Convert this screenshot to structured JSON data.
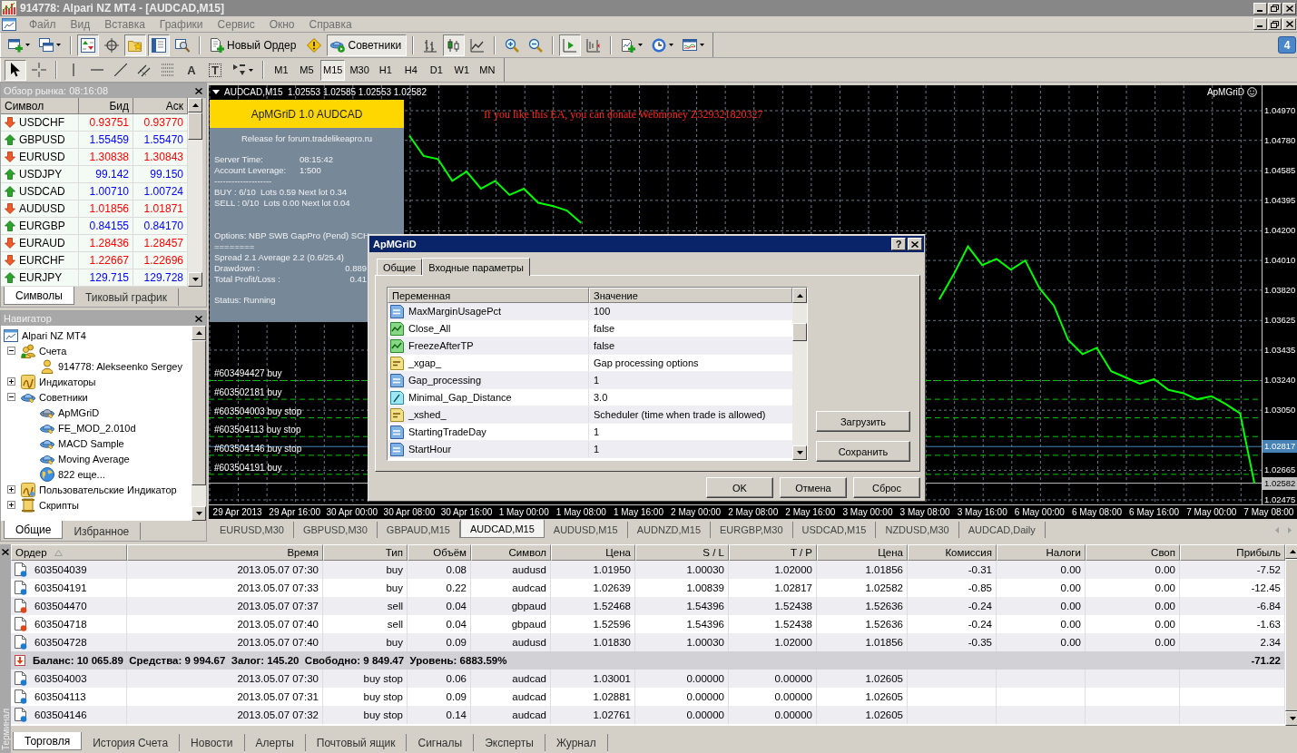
{
  "window": {
    "title": "914778: Alpari NZ MT4 - [AUDCAD,M15]"
  },
  "menu": [
    "Файл",
    "Вид",
    "Вставка",
    "Графики",
    "Сервис",
    "Окно",
    "Справка"
  ],
  "toolbar": [
    [
      {
        "kind": "new-chart",
        "dropdown": true,
        "pressed": false
      },
      {
        "kind": "profiles",
        "dropdown": true,
        "pressed": false
      }
    ],
    [
      {
        "kind": "market-watch",
        "dropdown": false,
        "pressed": true
      },
      {
        "kind": "navigator",
        "dropdown": false,
        "pressed": false
      },
      {
        "kind": "favorites",
        "dropdown": false,
        "pressed": true
      },
      {
        "kind": "terminal",
        "dropdown": false,
        "pressed": true
      },
      {
        "kind": "tester",
        "dropdown": false,
        "pressed": false
      }
    ],
    [
      {
        "kind": "new-order",
        "label": "Новый Ордер",
        "dropdown": false,
        "pressed": false
      },
      {
        "kind": "alert",
        "dropdown": false,
        "pressed": false
      },
      {
        "kind": "experts",
        "label": "Советники",
        "dropdown": false,
        "pressed": true
      }
    ],
    [
      {
        "kind": "bars",
        "dropdown": false,
        "pressed": false
      },
      {
        "kind": "candles",
        "dropdown": false,
        "pressed": true
      },
      {
        "kind": "line",
        "dropdown": false,
        "pressed": false
      }
    ],
    [
      {
        "kind": "zoom-in",
        "dropdown": false,
        "pressed": false
      },
      {
        "kind": "zoom-out",
        "dropdown": false,
        "pressed": false
      }
    ],
    [
      {
        "kind": "autoscroll",
        "dropdown": false,
        "pressed": true
      },
      {
        "kind": "shift",
        "dropdown": false,
        "pressed": false
      }
    ],
    [
      {
        "kind": "indicators",
        "dropdown": true,
        "pressed": false
      },
      {
        "kind": "periods",
        "dropdown": true,
        "pressed": false
      },
      {
        "kind": "templates",
        "dropdown": true,
        "pressed": false
      }
    ]
  ],
  "messages_badge": "4",
  "drawing_tools": [
    [
      {
        "kind": "cursor",
        "dropdown": false,
        "pressed": true
      },
      {
        "kind": "crosshair",
        "dropdown": false,
        "pressed": false
      }
    ],
    [
      {
        "kind": "vline",
        "dropdown": false,
        "pressed": false
      },
      {
        "kind": "hline",
        "dropdown": false,
        "pressed": false
      },
      {
        "kind": "trendline",
        "dropdown": false,
        "pressed": false
      },
      {
        "kind": "channel",
        "dropdown": false,
        "pressed": false
      },
      {
        "kind": "fibo",
        "dropdown": false,
        "pressed": false
      },
      {
        "kind": "text",
        "label": "A",
        "dropdown": false,
        "pressed": false
      },
      {
        "kind": "label",
        "label": "T",
        "dropdown": false,
        "pressed": false
      },
      {
        "kind": "arrows",
        "dropdown": true,
        "pressed": false
      }
    ]
  ],
  "timeframes": [
    {
      "label": "M1",
      "selected": false
    },
    {
      "label": "M5",
      "selected": false
    },
    {
      "label": "M15",
      "selected": true
    },
    {
      "label": "M30",
      "selected": false
    },
    {
      "label": "H1",
      "selected": false
    },
    {
      "label": "H4",
      "selected": false
    },
    {
      "label": "D1",
      "selected": false
    },
    {
      "label": "W1",
      "selected": false
    },
    {
      "label": "MN",
      "selected": false
    }
  ],
  "market_watch": {
    "title": "Обзор рынка: 08:16:08",
    "columns": [
      "Символ",
      "Бид",
      "Аск"
    ],
    "rows": [
      {
        "symbol": "USDCHF",
        "bid": "0.93751",
        "ask": "0.93770",
        "rising": false
      },
      {
        "symbol": "GBPUSD",
        "bid": "1.55459",
        "ask": "1.55470",
        "rising": true
      },
      {
        "symbol": "EURUSD",
        "bid": "1.30838",
        "ask": "1.30843",
        "rising": false
      },
      {
        "symbol": "USDJPY",
        "bid": "99.142",
        "ask": "99.150",
        "rising": true
      },
      {
        "symbol": "USDCAD",
        "bid": "1.00710",
        "ask": "1.00724",
        "rising": true
      },
      {
        "symbol": "AUDUSD",
        "bid": "1.01856",
        "ask": "1.01871",
        "rising": false
      },
      {
        "symbol": "EURGBP",
        "bid": "0.84155",
        "ask": "0.84170",
        "rising": true
      },
      {
        "symbol": "EURAUD",
        "bid": "1.28436",
        "ask": "1.28457",
        "rising": false
      },
      {
        "symbol": "EURCHF",
        "bid": "1.22667",
        "ask": "1.22696",
        "rising": false
      },
      {
        "symbol": "EURJPY",
        "bid": "129.715",
        "ask": "129.728",
        "rising": true
      }
    ],
    "tabs": [
      {
        "label": "Символы",
        "selected": true
      },
      {
        "label": "Тиковый график",
        "selected": false
      }
    ]
  },
  "navigator": {
    "title": "Навигатор",
    "tree": [
      {
        "label": "Alpari NZ MT4",
        "kind": "terminal",
        "children": [
          {
            "label": "Счета",
            "kind": "accounts",
            "expanded": true,
            "children": [
              {
                "label": "914778: Alekseenko Sergey",
                "kind": "account"
              }
            ]
          },
          {
            "label": "Индикаторы",
            "kind": "indicators",
            "expanded": false
          },
          {
            "label": "Советники",
            "kind": "experts",
            "expanded": true,
            "children": [
              {
                "label": "ApMGriD",
                "kind": "expert-grey"
              },
              {
                "label": "FE_MOD_2.010d",
                "kind": "expert"
              },
              {
                "label": "MACD Sample",
                "kind": "expert"
              },
              {
                "label": "Moving Average",
                "kind": "expert"
              },
              {
                "label": "822 еще...",
                "kind": "globe"
              }
            ]
          },
          {
            "label": "Пользовательские Индикатор",
            "kind": "custom-indicators",
            "expanded": false
          },
          {
            "label": "Скрипты",
            "kind": "scripts",
            "expanded": false
          }
        ]
      }
    ],
    "tabs": [
      {
        "label": "Общие",
        "selected": true
      },
      {
        "label": "Избранное",
        "selected": false
      }
    ]
  },
  "chart": {
    "header": "AUDCAD,M15  1.02553 1.02585 1.02553 1.02582",
    "expert_label": "ApMGriD",
    "notice": "If you like this EA, you can donate Webmoney Z329321820327",
    "info_panel": {
      "title": "ApMGriD 1.0 AUDCAD",
      "blocks": [
        [
          {
            "kind": "center",
            "text": "Release for forum.tradelikeapro.ru"
          }
        ],
        [
          {
            "kind": "pair",
            "label": "Server Time:",
            "value": "08:15:42"
          },
          {
            "kind": "pair",
            "label": "Account Leverage:",
            "value": "1:500"
          },
          {
            "kind": "text",
            "text": "--------------------"
          },
          {
            "kind": "text",
            "text": "BUY : 6/10  Lots 0.59 Next lot 0.34"
          },
          {
            "kind": "text",
            "text": "SELL : 0/10  Lots 0.00 Next lot 0.04"
          }
        ],
        [
          {
            "kind": "text",
            "text": "Options: NBP SWB GapPro (Pend) SCH"
          },
          {
            "kind": "text",
            "text": "========"
          },
          {
            "kind": "text",
            "text": "Spread 2.1 Average 2.2 (0.6/25.4)"
          },
          {
            "kind": "total",
            "label": "Drawdown :",
            "value": "0.889"
          },
          {
            "kind": "total",
            "label": "Total Profit/Loss :",
            "value": "0.41"
          }
        ],
        [
          {
            "kind": "text",
            "text": "Status: Running"
          }
        ]
      ]
    },
    "chart_data": {
      "type": "line",
      "grid": true,
      "categories": [
        null,
        null,
        "29 Apr 2013",
        null,
        null,
        null,
        "29 Apr 16:00",
        null,
        null,
        null,
        "30 Apr 00:00",
        null,
        null,
        null,
        "30 Apr 08:00",
        null,
        null,
        null,
        "30 Apr 16:00",
        null,
        null,
        null,
        "1 May 00:00",
        null,
        null,
        null,
        "1 May 08:00",
        null,
        null,
        null,
        "1 May 16:00",
        null,
        null,
        null,
        "2 May 00:00",
        null,
        null,
        null,
        "2 May 08:00",
        null,
        null,
        null,
        "2 May 16:00",
        null,
        null,
        null,
        "3 May 00:00",
        null,
        null,
        null,
        "3 May 08:00",
        null,
        null,
        null,
        "3 May 16:00",
        null,
        null,
        null,
        "6 May 00:00",
        null,
        null,
        null,
        "6 May 08:00",
        null,
        null,
        null,
        "6 May 16:00",
        null,
        null,
        null,
        "7 May 00:00",
        null,
        null,
        null,
        "7 May 08:00"
      ],
      "ylim": [
        1.02446,
        1.05133
      ],
      "yticks": [
        {
          "value": 1.0497,
          "label": "1.04970"
        },
        {
          "value": 1.0478,
          "label": "1.04780"
        },
        {
          "value": 1.04585,
          "label": "1.04585"
        },
        {
          "value": 1.04395,
          "label": "1.04395"
        },
        {
          "value": 1.042,
          "label": "1.04200"
        },
        {
          "value": 1.0401,
          "label": "1.04010"
        },
        {
          "value": 1.0382,
          "label": "1.03820"
        },
        {
          "value": 1.03625,
          "label": "1.03625"
        },
        {
          "value": 1.03435,
          "label": "1.03435"
        },
        {
          "value": 1.0324,
          "label": "1.03240"
        },
        {
          "value": 1.0305,
          "label": "1.03050"
        },
        {
          "value": 1.02665,
          "label": "1.02665"
        },
        {
          "value": 1.02475,
          "label": "1.02475"
        }
      ],
      "series": [
        {
          "color": "#00ff00",
          "values": [
            null,
            null,
            null,
            null,
            null,
            null,
            null,
            null,
            null,
            null,
            null,
            null,
            null,
            null,
            1.0481,
            1.0468,
            1.0466,
            1.0452,
            1.0458,
            1.0447,
            1.0452,
            1.0443,
            1.0447,
            1.0438,
            1.0436,
            1.0433,
            1.0425,
            null,
            null,
            null,
            null,
            null,
            null,
            null,
            null,
            null,
            null,
            null,
            null,
            null,
            null,
            null,
            null,
            null,
            null,
            null,
            null,
            null,
            null,
            null,
            null,
            1.0376,
            1.0392,
            1.041,
            1.0398,
            1.0402,
            1.0395,
            1.0401,
            1.0383,
            1.0372,
            1.035,
            1.0341,
            1.0345,
            1.033,
            1.0326,
            1.0322,
            1.0325,
            1.0318,
            1.0316,
            1.0312,
            1.0314,
            1.0309,
            1.0303,
            1.0258,
            null
          ]
        }
      ],
      "ref_lines": [
        {
          "axis": "y",
          "value": 1.0324,
          "label": "#603494427 buy",
          "color": "#00c800"
        },
        {
          "axis": "y",
          "value": 1.0312,
          "label": "#603502181 buy",
          "color": "#00c800"
        },
        {
          "axis": "y",
          "value": 1.03001,
          "label": "#603504003 buy stop",
          "color": "#00c800"
        },
        {
          "axis": "y",
          "value": 1.02881,
          "label": "#603504113 buy stop",
          "color": "#00c800"
        },
        {
          "axis": "y",
          "value": 1.02761,
          "label": "#603504146 buy stop",
          "color": "#00c800"
        },
        {
          "axis": "y",
          "value": 1.02639,
          "label": "#603504191 buy",
          "color": "#00c800"
        },
        {
          "axis": "y",
          "value": 1.02817,
          "color": "#4682b4"
        },
        {
          "axis": "y",
          "value": 1.02582,
          "color": "#c0c0c0"
        }
      ],
      "annotations": [
        {
          "text": "1.02817",
          "y": 1.02817
        },
        {
          "text": "1.02582",
          "y": 1.02582
        }
      ]
    }
  },
  "dialog": {
    "title": "ApMGriD",
    "help_button": "?",
    "tabs": [
      {
        "label": "Общие",
        "selected": false
      },
      {
        "label": "Входные параметры",
        "selected": true
      }
    ],
    "columns": [
      "Переменная",
      "Значение"
    ],
    "params": [
      {
        "name": "MaxMarginUsagePct",
        "value": "100",
        "kind": "int"
      },
      {
        "name": "Close_All",
        "value": "false",
        "kind": "bool"
      },
      {
        "name": "FreezeAfterTP",
        "value": "false",
        "kind": "bool"
      },
      {
        "name": "_xgap_",
        "value": "Gap processing options",
        "kind": "string"
      },
      {
        "name": "Gap_processing",
        "value": "1",
        "kind": "int"
      },
      {
        "name": "Minimal_Gap_Distance",
        "value": "3.0",
        "kind": "double"
      },
      {
        "name": "_xshed_",
        "value": "Scheduler (time when trade is allowed)",
        "kind": "string"
      },
      {
        "name": "StartingTradeDay",
        "value": "1",
        "kind": "int"
      },
      {
        "name": "StartHour",
        "value": "1",
        "kind": "int"
      }
    ],
    "side_buttons": [
      "Загрузить",
      "Сохранить"
    ],
    "buttons": [
      "OK",
      "Отмена",
      "Сброс"
    ]
  },
  "chart_tabs": [
    {
      "label": "EURUSD,M30",
      "selected": false
    },
    {
      "label": "GBPUSD,M30",
      "selected": false
    },
    {
      "label": "GBPAUD,M15",
      "selected": false
    },
    {
      "label": "AUDCAD,M15",
      "selected": true
    },
    {
      "label": "AUDUSD,M15",
      "selected": false
    },
    {
      "label": "AUDNZD,M15",
      "selected": false
    },
    {
      "label": "EURGBP,M30",
      "selected": false
    },
    {
      "label": "USDCAD,M15",
      "selected": false
    },
    {
      "label": "NZDUSD,M30",
      "selected": false
    },
    {
      "label": "AUDCAD,Daily",
      "selected": false
    }
  ],
  "terminal": {
    "label": "Терминал",
    "columns": [
      {
        "label": "Ордер",
        "sorted": true
      },
      {
        "label": "Время",
        "sorted": false
      },
      {
        "label": "Тип",
        "sorted": false
      },
      {
        "label": "Объём",
        "sorted": false
      },
      {
        "label": "Символ",
        "sorted": false
      },
      {
        "label": "Цена",
        "sorted": false
      },
      {
        "label": "S / L",
        "sorted": false
      },
      {
        "label": "T / P",
        "sorted": false
      },
      {
        "label": "Цена",
        "sorted": false
      },
      {
        "label": "Комиссия",
        "sorted": false
      },
      {
        "label": "Налоги",
        "sorted": false
      },
      {
        "label": "Своп",
        "sorted": false
      },
      {
        "label": "Прибыль",
        "sorted": false
      }
    ],
    "rows": [
      {
        "kind": "buy",
        "cells": [
          "603504039",
          "2013.05.07 07:30",
          "buy",
          "0.08",
          "audusd",
          "1.01950",
          "1.00030",
          "1.02000",
          "1.01856",
          "-0.31",
          "0.00",
          "0.00",
          "-7.52"
        ]
      },
      {
        "kind": "buy",
        "cells": [
          "603504191",
          "2013.05.07 07:33",
          "buy",
          "0.22",
          "audcad",
          "1.02639",
          "1.00839",
          "1.02817",
          "1.02582",
          "-0.85",
          "0.00",
          "0.00",
          "-12.45"
        ]
      },
      {
        "kind": "sell",
        "cells": [
          "603504470",
          "2013.05.07 07:37",
          "sell",
          "0.04",
          "gbpaud",
          "1.52468",
          "1.54396",
          "1.52438",
          "1.52636",
          "-0.24",
          "0.00",
          "0.00",
          "-6.84"
        ]
      },
      {
        "kind": "sell",
        "cells": [
          "603504718",
          "2013.05.07 07:40",
          "sell",
          "0.04",
          "gbpaud",
          "1.52596",
          "1.54396",
          "1.52438",
          "1.52636",
          "-0.24",
          "0.00",
          "0.00",
          "-1.63"
        ]
      },
      {
        "kind": "buy",
        "cells": [
          "603504728",
          "2013.05.07 07:40",
          "buy",
          "0.09",
          "audusd",
          "1.01830",
          "1.00030",
          "1.02000",
          "1.01856",
          "-0.35",
          "0.00",
          "0.00",
          "2.34"
        ]
      },
      {
        "kind": "summary",
        "text": "Баланс: 10 065.89  Средства: 9 994.67  Залог: 145.20  Свободно: 9 849.47  Уровень: 6883.59%",
        "total": "-71.22"
      },
      {
        "kind": "buy",
        "cells": [
          "603504003",
          "2013.05.07 07:30",
          "buy stop",
          "0.06",
          "audcad",
          "1.03001",
          "0.00000",
          "0.00000",
          "1.02605"
        ]
      },
      {
        "kind": "buy",
        "cells": [
          "603504113",
          "2013.05.07 07:31",
          "buy stop",
          "0.09",
          "audcad",
          "1.02881",
          "0.00000",
          "0.00000",
          "1.02605"
        ]
      },
      {
        "kind": "buy",
        "cells": [
          "603504146",
          "2013.05.07 07:32",
          "buy stop",
          "0.14",
          "audcad",
          "1.02761",
          "0.00000",
          "0.00000",
          "1.02605"
        ]
      }
    ],
    "tabs": [
      {
        "label": "Торговля",
        "selected": true
      },
      {
        "label": "История Счета",
        "selected": false
      },
      {
        "label": "Новости",
        "selected": false
      },
      {
        "label": "Алерты",
        "selected": false
      },
      {
        "label": "Почтовый ящик",
        "selected": false
      },
      {
        "label": "Сигналы",
        "selected": false
      },
      {
        "label": "Эксперты",
        "selected": false
      },
      {
        "label": "Журнал",
        "selected": false
      }
    ]
  }
}
